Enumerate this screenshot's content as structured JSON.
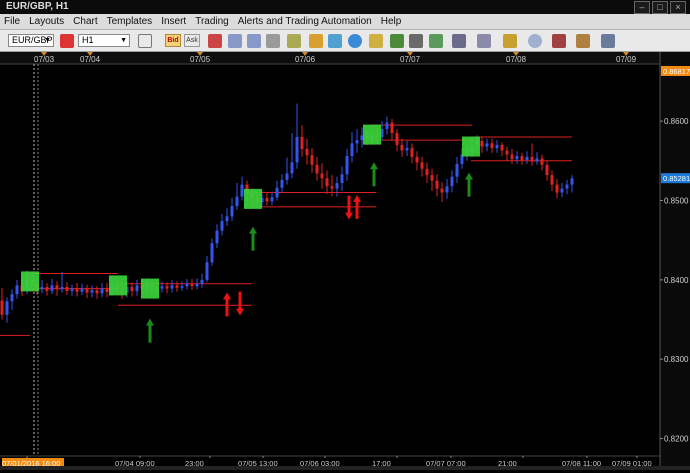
{
  "window": {
    "title": "EUR/GBP, H1"
  },
  "menu": [
    "File",
    "Layouts",
    "Chart",
    "Templates",
    "Insert",
    "Trading",
    "Alerts and Trading Automation",
    "Help"
  ],
  "toolbar": {
    "symbol": "EUR/GBP",
    "timeframe": "H1",
    "bid_label": "Bid",
    "ask_label": "Ask"
  },
  "chart_data": {
    "type": "candlestick",
    "indicator_text": "",
    "top_dates": [
      "07/03",
      "07/04",
      "07/05",
      "07/06",
      "07/07",
      "07/08",
      "07/09"
    ],
    "bottom_labels": [
      "07/01/2016 16:00",
      "07/04 09:00",
      "23:00",
      "07/05 13:00",
      "07/06 03:00",
      "17:00",
      "07/07 07:00",
      "21:00",
      "07/08 11:00",
      "07/09 01:00"
    ],
    "y_ticks": [
      "0.8600",
      "0.8500",
      "0.8400",
      "0.8300",
      "0.8200"
    ],
    "ylim": [
      0.8178,
      0.8672
    ],
    "last_price": "0.85281",
    "top_price": "0.86817",
    "colors": {
      "up": "#3355ee",
      "down": "#dd2222",
      "level": "#e02020",
      "box": "#39d43a",
      "up_arrow": "#1e8a1e",
      "down_arrow": "#ee1111",
      "axis_text": "#cfcfcf"
    },
    "levels": [
      {
        "y": 0.8408,
        "x_start": 28,
        "x_end": 118
      },
      {
        "y": 0.8389,
        "x_start": 28,
        "x_end": 118
      },
      {
        "y": 0.8395,
        "x_start": 118,
        "x_end": 252
      },
      {
        "y": 0.8368,
        "x_start": 118,
        "x_end": 252
      },
      {
        "y": 0.851,
        "x_start": 252,
        "x_end": 376
      },
      {
        "y": 0.8492,
        "x_start": 252,
        "x_end": 376
      },
      {
        "y": 0.8595,
        "x_start": 371,
        "x_end": 472
      },
      {
        "y": 0.8576,
        "x_start": 371,
        "x_end": 472
      },
      {
        "y": 0.858,
        "x_start": 471,
        "x_end": 572
      },
      {
        "y": 0.855,
        "x_start": 471,
        "x_end": 572
      },
      {
        "y": 0.833,
        "x_start": 0,
        "x_end": 30
      }
    ],
    "boxes": [
      {
        "x": 30,
        "y": 0.8398
      },
      {
        "x": 118,
        "y": 0.8393
      },
      {
        "x": 150,
        "y": 0.8389
      },
      {
        "x": 253,
        "y": 0.8502
      },
      {
        "x": 372,
        "y": 0.8583
      },
      {
        "x": 471,
        "y": 0.8568
      }
    ],
    "arrows_up": [
      {
        "x": 150,
        "y": 0.8336
      },
      {
        "x": 253,
        "y": 0.8452
      },
      {
        "x": 374,
        "y": 0.8533
      },
      {
        "x": 469,
        "y": 0.852
      },
      {
        "x": 227,
        "y": 0.8369
      },
      {
        "x": 357,
        "y": 0.8492
      }
    ],
    "arrows_down": [
      {
        "x": 240,
        "y": 0.837
      },
      {
        "x": 349,
        "y": 0.8491
      }
    ],
    "candles": [
      [
        2,
        0.8374,
        0.8356,
        0.839,
        0.835
      ],
      [
        7,
        0.8356,
        0.8373,
        0.8378,
        0.8346
      ],
      [
        12,
        0.8373,
        0.8382,
        0.8388,
        0.8362
      ],
      [
        17,
        0.8382,
        0.8393,
        0.84,
        0.8376
      ],
      [
        22,
        0.8393,
        0.8386,
        0.8404,
        0.838
      ],
      [
        27,
        0.8386,
        0.84,
        0.8412,
        0.8382
      ],
      [
        32,
        0.84,
        0.8396,
        0.8407,
        0.8386
      ],
      [
        37,
        0.8396,
        0.8388,
        0.8402,
        0.8381
      ],
      [
        42,
        0.8388,
        0.8391,
        0.84,
        0.8383
      ],
      [
        47,
        0.8391,
        0.8386,
        0.8396,
        0.838
      ],
      [
        52,
        0.8386,
        0.8393,
        0.8401,
        0.8382
      ],
      [
        57,
        0.8393,
        0.8388,
        0.8398,
        0.838
      ],
      [
        62,
        0.8388,
        0.8391,
        0.841,
        0.8384
      ],
      [
        67,
        0.8391,
        0.8386,
        0.8397,
        0.8381
      ],
      [
        72,
        0.8386,
        0.8389,
        0.8394,
        0.838
      ],
      [
        77,
        0.8389,
        0.8385,
        0.8396,
        0.8379
      ],
      [
        82,
        0.8385,
        0.8389,
        0.8395,
        0.8381
      ],
      [
        87,
        0.8389,
        0.8384,
        0.8394,
        0.8377
      ],
      [
        92,
        0.8384,
        0.8387,
        0.8393,
        0.8378
      ],
      [
        97,
        0.8387,
        0.8383,
        0.8392,
        0.8376
      ],
      [
        102,
        0.8383,
        0.8389,
        0.8396,
        0.8378
      ],
      [
        107,
        0.8389,
        0.8385,
        0.8396,
        0.8378
      ],
      [
        112,
        0.8385,
        0.8392,
        0.8399,
        0.838
      ],
      [
        117,
        0.8392,
        0.8387,
        0.8399,
        0.8381
      ],
      [
        122,
        0.8387,
        0.8384,
        0.8394,
        0.8376
      ],
      [
        127,
        0.8384,
        0.8391,
        0.8398,
        0.8378
      ],
      [
        132,
        0.8391,
        0.8386,
        0.8397,
        0.8379
      ],
      [
        137,
        0.8386,
        0.8393,
        0.84,
        0.838
      ],
      [
        142,
        0.8393,
        0.8389,
        0.8401,
        0.8382
      ],
      [
        147,
        0.8389,
        0.8394,
        0.8402,
        0.8383
      ],
      [
        152,
        0.8394,
        0.8391,
        0.84,
        0.8385
      ],
      [
        157,
        0.8391,
        0.8389,
        0.8397,
        0.8383
      ],
      [
        162,
        0.8389,
        0.8392,
        0.8398,
        0.8384
      ],
      [
        167,
        0.8392,
        0.8389,
        0.8397,
        0.8383
      ],
      [
        172,
        0.8389,
        0.8393,
        0.84,
        0.8384
      ],
      [
        177,
        0.8393,
        0.839,
        0.8398,
        0.8385
      ],
      [
        182,
        0.839,
        0.8392,
        0.8398,
        0.8386
      ],
      [
        187,
        0.8392,
        0.8395,
        0.8401,
        0.8388
      ],
      [
        192,
        0.8395,
        0.8392,
        0.8401,
        0.8387
      ],
      [
        197,
        0.8392,
        0.8395,
        0.8402,
        0.8388
      ],
      [
        202,
        0.8395,
        0.84,
        0.8408,
        0.839
      ],
      [
        207,
        0.84,
        0.8422,
        0.843,
        0.8397
      ],
      [
        212,
        0.8422,
        0.8446,
        0.8452,
        0.8418
      ],
      [
        217,
        0.8446,
        0.8462,
        0.847,
        0.844
      ],
      [
        222,
        0.8462,
        0.8474,
        0.8483,
        0.8456
      ],
      [
        227,
        0.8474,
        0.848,
        0.849,
        0.8468
      ],
      [
        232,
        0.848,
        0.8493,
        0.8503,
        0.8474
      ],
      [
        237,
        0.8493,
        0.8505,
        0.8522,
        0.8488
      ],
      [
        242,
        0.8505,
        0.852,
        0.853,
        0.85
      ],
      [
        247,
        0.852,
        0.851,
        0.8525,
        0.85
      ],
      [
        252,
        0.851,
        0.8503,
        0.8515,
        0.8495
      ],
      [
        257,
        0.8503,
        0.8498,
        0.851,
        0.8492
      ],
      [
        262,
        0.8498,
        0.8503,
        0.8509,
        0.8492
      ],
      [
        267,
        0.8503,
        0.8499,
        0.851,
        0.8494
      ],
      [
        272,
        0.8499,
        0.8504,
        0.8511,
        0.8494
      ],
      [
        277,
        0.8504,
        0.8516,
        0.8525,
        0.85
      ],
      [
        282,
        0.8516,
        0.8526,
        0.8533,
        0.851
      ],
      [
        287,
        0.8526,
        0.8534,
        0.8554,
        0.852
      ],
      [
        292,
        0.8534,
        0.8548,
        0.8585,
        0.8528
      ],
      [
        297,
        0.8548,
        0.858,
        0.8622,
        0.854
      ],
      [
        302,
        0.858,
        0.8565,
        0.8595,
        0.8555
      ],
      [
        307,
        0.8565,
        0.8557,
        0.8578,
        0.8545
      ],
      [
        312,
        0.8557,
        0.8545,
        0.8566,
        0.8535
      ],
      [
        317,
        0.8545,
        0.8534,
        0.8555,
        0.8525
      ],
      [
        322,
        0.8534,
        0.8528,
        0.8547,
        0.8515
      ],
      [
        327,
        0.8528,
        0.8518,
        0.8538,
        0.8508
      ],
      [
        332,
        0.8518,
        0.8515,
        0.8532,
        0.8505
      ],
      [
        337,
        0.8515,
        0.8522,
        0.853,
        0.8505
      ],
      [
        342,
        0.8522,
        0.8533,
        0.8543,
        0.8512
      ],
      [
        347,
        0.8533,
        0.8556,
        0.8565,
        0.8525
      ],
      [
        352,
        0.8556,
        0.8572,
        0.8586,
        0.8548
      ],
      [
        357,
        0.8572,
        0.8576,
        0.859,
        0.856
      ],
      [
        362,
        0.8576,
        0.8582,
        0.8592,
        0.8567
      ],
      [
        367,
        0.8582,
        0.8578,
        0.8588,
        0.857
      ],
      [
        372,
        0.8578,
        0.8583,
        0.859,
        0.8572
      ],
      [
        377,
        0.8583,
        0.858,
        0.859,
        0.8572
      ],
      [
        382,
        0.858,
        0.859,
        0.86,
        0.8575
      ],
      [
        387,
        0.859,
        0.8598,
        0.8606,
        0.8583
      ],
      [
        392,
        0.8598,
        0.8585,
        0.8603,
        0.8576
      ],
      [
        397,
        0.8585,
        0.857,
        0.859,
        0.8562
      ],
      [
        402,
        0.857,
        0.8563,
        0.8578,
        0.8555
      ],
      [
        407,
        0.8563,
        0.8566,
        0.8575,
        0.8556
      ],
      [
        412,
        0.8566,
        0.8555,
        0.8572,
        0.8547
      ],
      [
        417,
        0.8555,
        0.8548,
        0.8562,
        0.8538
      ],
      [
        422,
        0.8548,
        0.854,
        0.8555,
        0.853
      ],
      [
        427,
        0.854,
        0.8532,
        0.8548,
        0.8522
      ],
      [
        432,
        0.8532,
        0.8525,
        0.854,
        0.8512
      ],
      [
        437,
        0.8525,
        0.8515,
        0.8533,
        0.8505
      ],
      [
        442,
        0.8515,
        0.851,
        0.8523,
        0.8498
      ],
      [
        447,
        0.851,
        0.8518,
        0.8527,
        0.8502
      ],
      [
        452,
        0.8518,
        0.853,
        0.8538,
        0.851
      ],
      [
        457,
        0.853,
        0.8546,
        0.8555,
        0.8522
      ],
      [
        462,
        0.8546,
        0.8558,
        0.8566,
        0.854
      ],
      [
        467,
        0.8558,
        0.8562,
        0.857,
        0.855
      ],
      [
        472,
        0.8562,
        0.8568,
        0.8578,
        0.8555
      ],
      [
        477,
        0.8568,
        0.8575,
        0.8582,
        0.856
      ],
      [
        482,
        0.8575,
        0.8568,
        0.858,
        0.856
      ],
      [
        487,
        0.8568,
        0.8572,
        0.8578,
        0.8562
      ],
      [
        492,
        0.8572,
        0.8566,
        0.8578,
        0.856
      ],
      [
        497,
        0.8566,
        0.857,
        0.8576,
        0.856
      ],
      [
        502,
        0.857,
        0.8563,
        0.8573,
        0.8556
      ],
      [
        507,
        0.8563,
        0.8558,
        0.8568,
        0.855
      ],
      [
        512,
        0.8558,
        0.8552,
        0.8565,
        0.8546
      ],
      [
        517,
        0.8552,
        0.8556,
        0.8562,
        0.8546
      ],
      [
        522,
        0.8556,
        0.8551,
        0.856,
        0.8545
      ],
      [
        527,
        0.8551,
        0.8555,
        0.8562,
        0.8546
      ],
      [
        532,
        0.8555,
        0.8549,
        0.8572,
        0.8544
      ],
      [
        537,
        0.8549,
        0.8553,
        0.8561,
        0.8545
      ],
      [
        542,
        0.8553,
        0.8545,
        0.8558,
        0.8538
      ],
      [
        547,
        0.8545,
        0.8532,
        0.855,
        0.8525
      ],
      [
        552,
        0.8532,
        0.852,
        0.8538,
        0.8512
      ],
      [
        557,
        0.852,
        0.851,
        0.8527,
        0.8503
      ],
      [
        562,
        0.851,
        0.8515,
        0.8522,
        0.8504
      ],
      [
        567,
        0.8515,
        0.852,
        0.8526,
        0.8508
      ],
      [
        572,
        0.852,
        0.8528,
        0.8532,
        0.851
      ]
    ]
  }
}
